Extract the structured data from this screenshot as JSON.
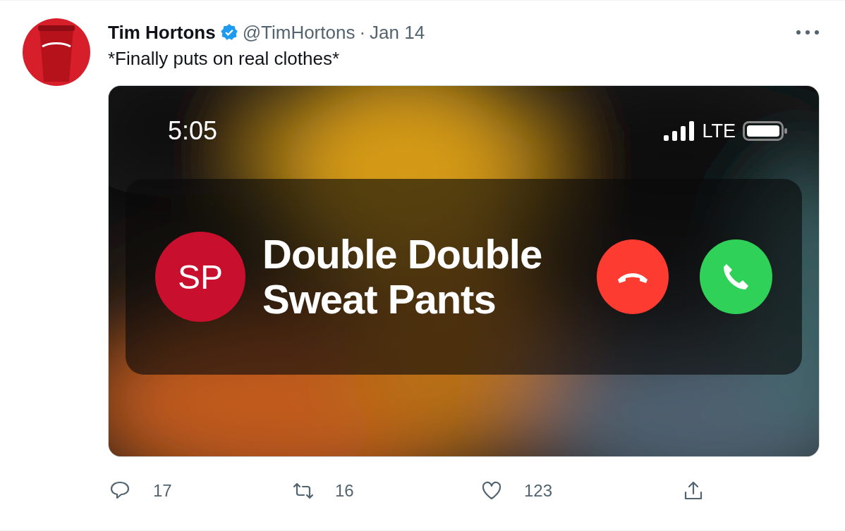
{
  "tweet": {
    "author": {
      "name": "Tim Hortons",
      "verified": true,
      "handle": "@TimHortons",
      "separator": "·",
      "date": "Jan 14"
    },
    "text": "*Finally puts on real clothes*",
    "media": {
      "kind": "phone-call",
      "time": "5:05",
      "network": "LTE",
      "caller_initials": "SP",
      "caller_name": "Double Double Sweat Pants"
    },
    "actions": [
      {
        "kind": "reply",
        "count": "17"
      },
      {
        "kind": "retweet",
        "count": "16"
      },
      {
        "kind": "like",
        "count": "123"
      },
      {
        "kind": "share"
      }
    ]
  }
}
